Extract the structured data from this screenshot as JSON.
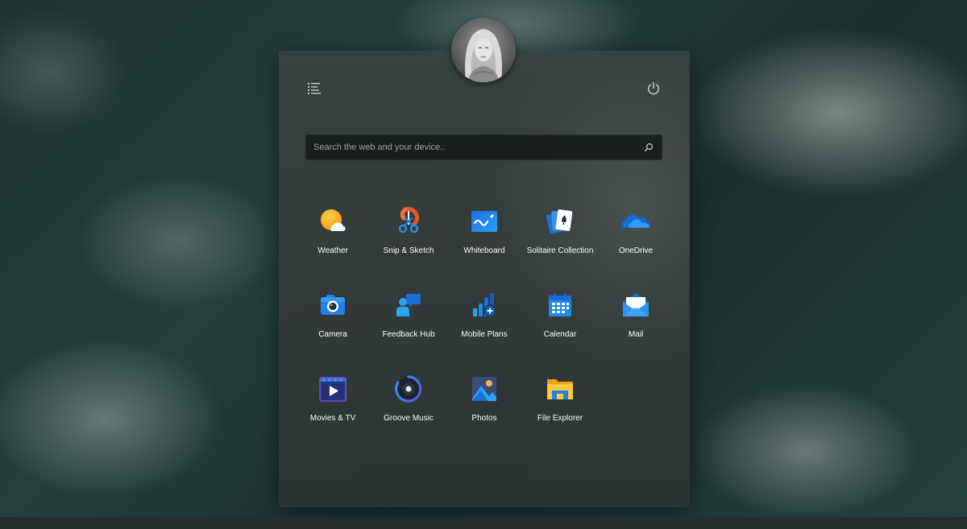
{
  "search": {
    "placeholder": "Search the web and your device.."
  },
  "apps": [
    {
      "label": "Weather",
      "icon": "weather-icon"
    },
    {
      "label": "Snip & Sketch",
      "icon": "snip-sketch-icon"
    },
    {
      "label": "Whiteboard",
      "icon": "whiteboard-icon"
    },
    {
      "label": "Solitaire Collection",
      "icon": "solitaire-icon"
    },
    {
      "label": "OneDrive",
      "icon": "onedrive-icon"
    },
    {
      "label": "Camera",
      "icon": "camera-icon"
    },
    {
      "label": "Feedback Hub",
      "icon": "feedback-hub-icon"
    },
    {
      "label": "Mobile Plans",
      "icon": "mobile-plans-icon"
    },
    {
      "label": "Calendar",
      "icon": "calendar-icon"
    },
    {
      "label": "Mail",
      "icon": "mail-icon"
    },
    {
      "label": "Movies & TV",
      "icon": "movies-tv-icon"
    },
    {
      "label": "Groove Music",
      "icon": "groove-music-icon"
    },
    {
      "label": "Photos",
      "icon": "photos-icon"
    },
    {
      "label": "File Explorer",
      "icon": "file-explorer-icon"
    }
  ],
  "icons": {
    "menu": "hamburger-list-icon",
    "power": "power-icon",
    "search": "search-icon",
    "avatar": "user-avatar"
  },
  "colors": {
    "panel": "#3a4040",
    "search_bg": "#161a1a",
    "text": "#ffffff",
    "accent_blue": "#1e90ff"
  }
}
